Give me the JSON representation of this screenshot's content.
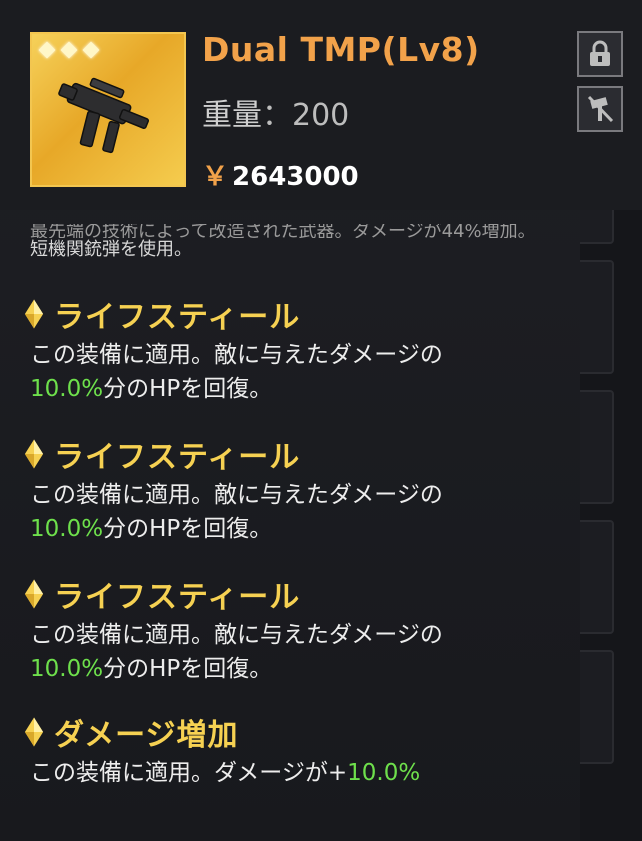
{
  "item": {
    "name": "Dual TMP(Lv8)",
    "weight_label": "重量",
    "weight_sep": "：",
    "weight_value": "200",
    "currency": "￥",
    "price": "2643000",
    "star_count": 3,
    "rarity_color": "#f3c650"
  },
  "buttons": {
    "lock_icon": "lock-icon",
    "unequip_icon": "hammer-off-icon"
  },
  "description": {
    "line1": "最先端の技術によって改造された武器。ダメージが44%増加。",
    "line2": "短機関銃弾を使用。"
  },
  "effects": [
    {
      "name": "ライフスティール",
      "text_prefix": "この装備に適用。敵に与えたダメージの",
      "value": "10.0%",
      "text_suffix": "分のHPを回復。"
    },
    {
      "name": "ライフスティール",
      "text_prefix": "この装備に適用。敵に与えたダメージの",
      "value": "10.0%",
      "text_suffix": "分のHPを回復。"
    },
    {
      "name": "ライフスティール",
      "text_prefix": "この装備に適用。敵に与えたダメージの",
      "value": "10.0%",
      "text_suffix": "分のHPを回復。"
    },
    {
      "name": "ダメージ増加",
      "text_prefix": "この装備に適用。ダメージが+",
      "value": "10.0%",
      "text_suffix": ""
    }
  ],
  "colors": {
    "title": "#f2a24a",
    "effect_name": "#f6d152",
    "highlight": "#6ee04c"
  }
}
